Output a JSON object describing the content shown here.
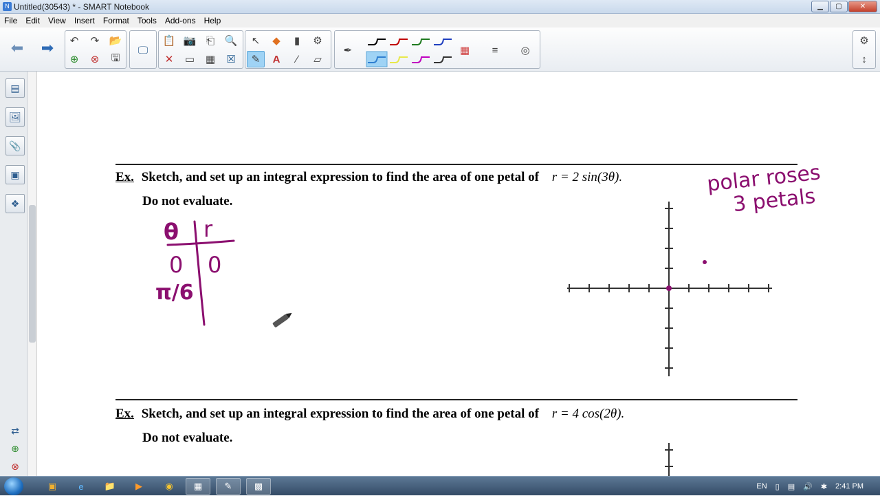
{
  "window": {
    "title": "Untitled(30543) * - SMART Notebook",
    "minimize": "▁",
    "maximize": "▢",
    "close": "✕"
  },
  "menu": {
    "items": [
      "File",
      "Edit",
      "View",
      "Insert",
      "Format",
      "Tools",
      "Add-ons",
      "Help"
    ]
  },
  "toolbar": {
    "back_icon": "arrow-left",
    "forward_icon": "arrow-right",
    "pen_colors": [
      "#000000",
      "#c00000",
      "#1f7a1f",
      "#1f3fbf",
      "#2f7fd0",
      "#e8e84a",
      "#c000c0",
      "#333333"
    ]
  },
  "page": {
    "q1": {
      "ex": "Ex.",
      "text": "Sketch, and set up an integral expression to find the area of one petal of",
      "formula": "r = 2 sin(3θ).",
      "sub": "Do not evaluate."
    },
    "q2": {
      "ex": "Ex.",
      "text": "Sketch, and set up an integral expression to find the area of one petal of",
      "formula": "r = 4 cos(2θ).",
      "sub": "Do not evaluate."
    },
    "handwriting": {
      "note_line1": "polar roses",
      "note_line2": "3 petals",
      "table_head_theta": "θ",
      "table_head_r": "r",
      "row1_theta": "0",
      "row1_r": "0",
      "row2_theta": "π/6"
    },
    "ink_color": "#8b0f6f"
  },
  "taskbar": {
    "lang": "EN",
    "time": "2:41 PM"
  }
}
